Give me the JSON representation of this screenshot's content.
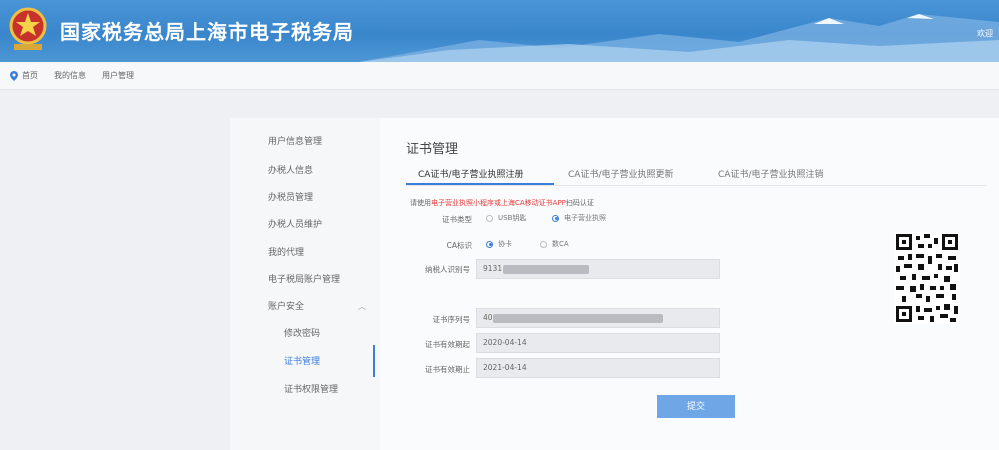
{
  "header": {
    "title": "国家税务总局上海市电子税务局",
    "emblem_icon": "tax-emblem-icon",
    "corner_text": "欢迎"
  },
  "breadcrumb": {
    "items": [
      "首页",
      "我的信息",
      "用户管理"
    ]
  },
  "sidebar": {
    "items": [
      {
        "label": "用户信息管理"
      },
      {
        "label": "办税人信息"
      },
      {
        "label": "办税员管理"
      },
      {
        "label": "办税人员维护"
      },
      {
        "label": "我的代理"
      },
      {
        "label": "电子税局账户管理"
      },
      {
        "label": "账户安全"
      },
      {
        "label": "修改密码"
      },
      {
        "label": "证书管理"
      },
      {
        "label": "证书权限管理"
      }
    ],
    "active": "证书管理"
  },
  "main": {
    "title": "证书管理",
    "tabs": [
      {
        "label": "CA证书/电子营业执照注册"
      },
      {
        "label": "CA证书/电子营业执照更新"
      },
      {
        "label": "CA证书/电子营业执照注销"
      }
    ],
    "notice_prefix": "请使用",
    "notice_red": "电子营业执照小程序或上海CA移动证书APP",
    "notice_suffix": "扫码认证",
    "form": {
      "cert_type_label": "证书类型",
      "cert_type_options": [
        "USB钥匙",
        "电子营业执照"
      ],
      "ca_label": "CA标识",
      "ca_options": [
        "协卡",
        "数CA"
      ],
      "taxpayer_id_label": "纳税人识别号",
      "taxpayer_id_value": "9131",
      "cert_serial_label": "证书序列号",
      "cert_serial_value": "40",
      "valid_from_label": "证书有效期起",
      "valid_from_value": "2020-04-14",
      "valid_to_label": "证书有效期止",
      "valid_to_value": "2021-04-14"
    },
    "submit_label": "提交"
  },
  "colors": {
    "header_blue": "#3a86cc",
    "accent": "#3b7dd8",
    "notice_red": "#e23b3b",
    "button": "#6ea6e6"
  }
}
